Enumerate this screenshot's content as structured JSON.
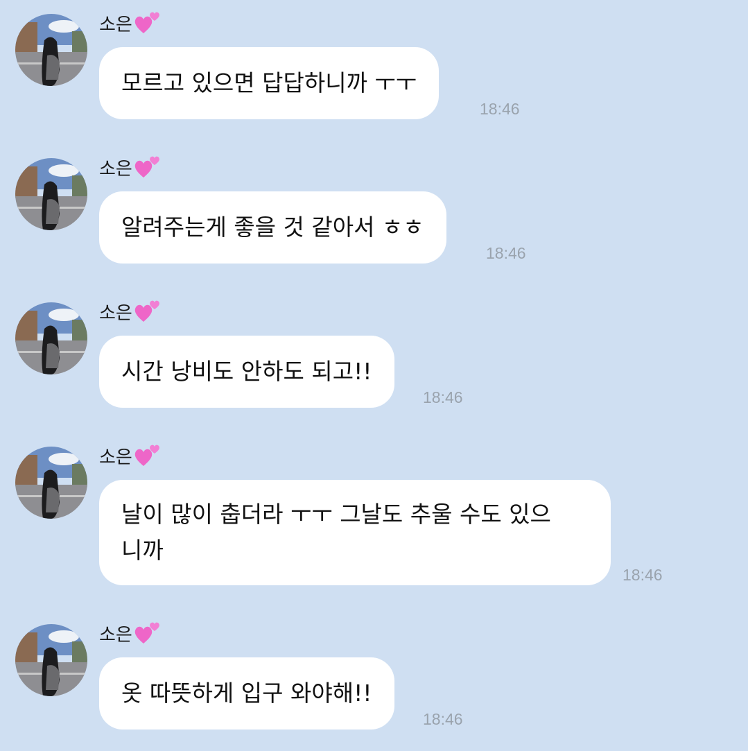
{
  "messages": [
    {
      "sender": "소은",
      "lines": [
        "모르고 있으면 답답하니까 ㅜㅜ"
      ],
      "time": "18:46"
    },
    {
      "sender": "소은",
      "lines": [
        "알려주는게 좋을 것 같아서 ㅎㅎ"
      ],
      "time": "18:46"
    },
    {
      "sender": "소은",
      "lines": [
        "시간 낭비도 안하도 되고!!"
      ],
      "time": "18:46"
    },
    {
      "sender": "소은",
      "lines": [
        "날이 많이 춥더라 ㅜㅜ 그날도 추울 수도 있으",
        "니까"
      ],
      "time": "18:46"
    },
    {
      "sender": "소은",
      "lines": [
        "옷 따뜻하게 입구 와야해!!"
      ],
      "time": "18:46"
    }
  ],
  "icons": {
    "sender_emoji": "two-hearts-icon",
    "avatar": "profile-photo"
  },
  "colors": {
    "background": "#cfdff2",
    "bubble": "#ffffff",
    "timestamp": "#9aa3ad",
    "heart": "#ee66c8"
  }
}
